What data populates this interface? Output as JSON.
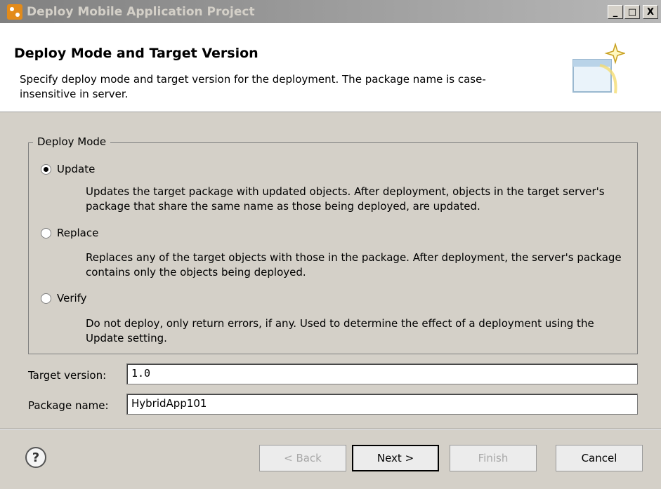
{
  "window": {
    "title": "Deploy Mobile Application Project",
    "minimize": "_",
    "maximize": "□",
    "close": "X"
  },
  "header": {
    "title": "Deploy Mode and Target Version",
    "description": "Specify deploy mode and target version for the deployment. The package name is case-insensitive in server."
  },
  "deploy_mode": {
    "legend": "Deploy Mode",
    "options": [
      {
        "label": "Update",
        "checked": true,
        "description": "Updates the target package with updated objects. After deployment, objects in the target server's package that share the same name as those being deployed, are updated."
      },
      {
        "label": "Replace",
        "checked": false,
        "description": "Replaces any of the target objects with those in the package. After deployment, the server's package contains only the objects being deployed."
      },
      {
        "label": "Verify",
        "checked": false,
        "description": "Do not deploy, only return errors, if any. Used to determine the effect of a deployment using the Update setting."
      }
    ]
  },
  "fields": {
    "target_version_label": "Target version:",
    "target_version_value": "1.0",
    "package_name_label": "Package name:",
    "package_name_value": "HybridApp101"
  },
  "buttons": {
    "help": "?",
    "back": "< Back",
    "next": "Next >",
    "finish": "Finish",
    "cancel": "Cancel"
  }
}
